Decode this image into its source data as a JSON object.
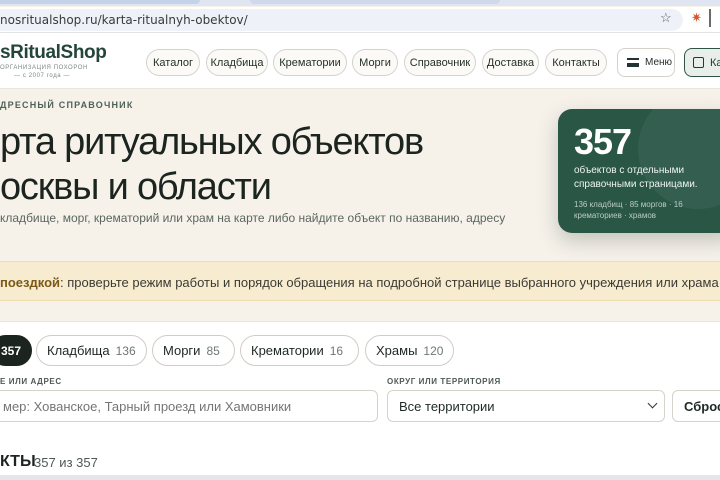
{
  "browser": {
    "url": "nosritualshop.ru/karta-ritualnyh-obektov/"
  },
  "header": {
    "logo": "sRitualShop",
    "logo_sub": "организация похорон",
    "logo_since": "— с 2007 года —",
    "nav": [
      "Каталог",
      "Кладбища",
      "Крематории",
      "Морги",
      "Справочник",
      "Доставка",
      "Контакты"
    ],
    "menu_label": "Меню",
    "map_label": "Карт"
  },
  "hero": {
    "eyebrow": "ДРЕСНЫЙ СПРАВОЧНИК",
    "title_line1": "рта ритуальных объектов",
    "title_line2": "осквы и области",
    "subtitle": "кладбище, морг, крематорий или храм на карте либо найдите объект по названию, адресу"
  },
  "stats": {
    "total": "357",
    "caption": "объектов с отдельными справочными страницами.",
    "detail": "136 кладбищ · 85 моргов · 16 крематориев · храмов"
  },
  "notice": {
    "lead": "поездкой",
    "text": ": проверьте режим работы и порядок обращения на подробной странице выбранного учреждения или храма"
  },
  "filters": {
    "chips": [
      {
        "label": "",
        "count": "357"
      },
      {
        "label": "Кладбища",
        "count": "136"
      },
      {
        "label": "Морги",
        "count": "85"
      },
      {
        "label": "Крематории",
        "count": "16"
      },
      {
        "label": "Храмы",
        "count": "120"
      }
    ],
    "search_label": "Е ИЛИ АДРЕС",
    "search_placeholder": "мер: Хованское, Тарный проезд или Хамовники",
    "district_label": "ОКРУГ ИЛИ ТЕРРИТОРИЯ",
    "district_value": "Все территории",
    "reset_label": "Сброс"
  },
  "results": {
    "title": "КТЫ",
    "count": "357 из 357"
  }
}
